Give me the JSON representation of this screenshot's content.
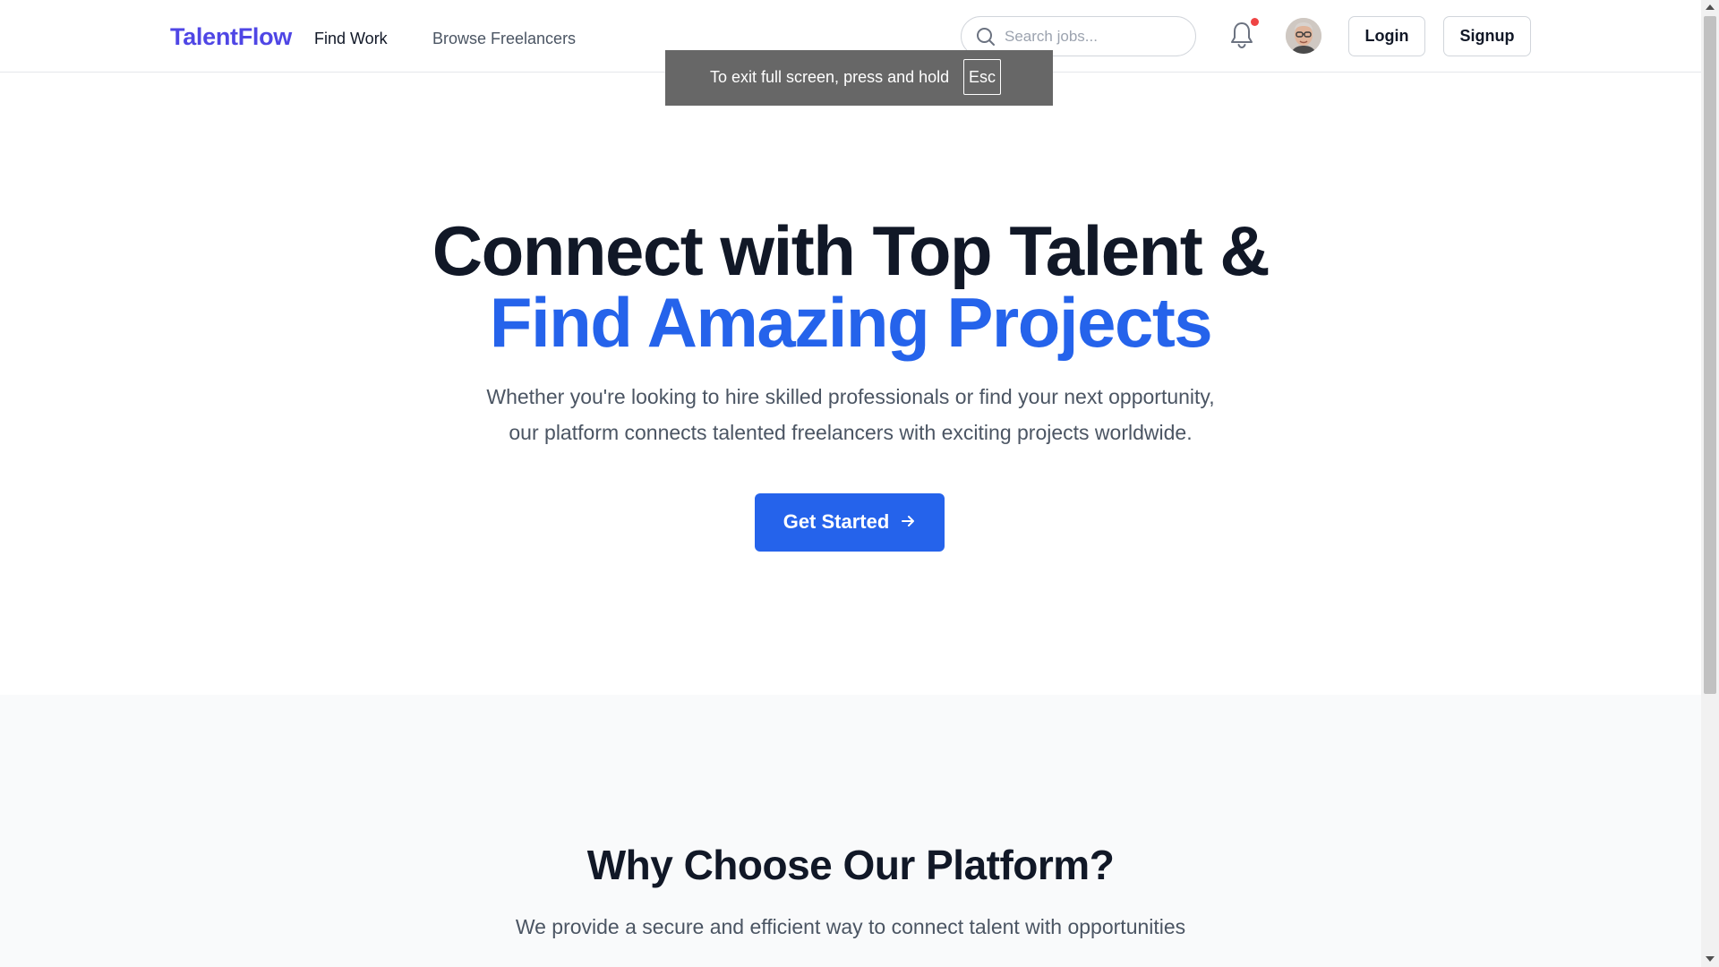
{
  "brand": {
    "name": "TalentFlow",
    "color": "#4f46e5"
  },
  "nav": {
    "items": [
      {
        "label": "Find Work"
      },
      {
        "label": "Browse Freelancers"
      }
    ]
  },
  "search": {
    "placeholder": "Search jobs...",
    "value": ""
  },
  "header": {
    "notification_icon": "bell-icon",
    "has_unread": true,
    "login_label": "Login",
    "signup_label": "Signup"
  },
  "fullscreen_notice": {
    "message": "To exit full screen, press and hold",
    "key": "Esc"
  },
  "hero": {
    "title_line1": "Connect with Top Talent &",
    "title_line2": "Find Amazing Projects",
    "subtitle_line1": "Whether you're looking to hire skilled professionals or find your next opportunity,",
    "subtitle_line2": "our platform connects talented freelancers with exciting projects worldwide.",
    "cta_label": "Get Started",
    "accent_color": "#2563eb"
  },
  "features": {
    "title": "Why Choose Our Platform?",
    "subtitle": "We provide a secure and efficient way to connect talent with opportunities"
  }
}
